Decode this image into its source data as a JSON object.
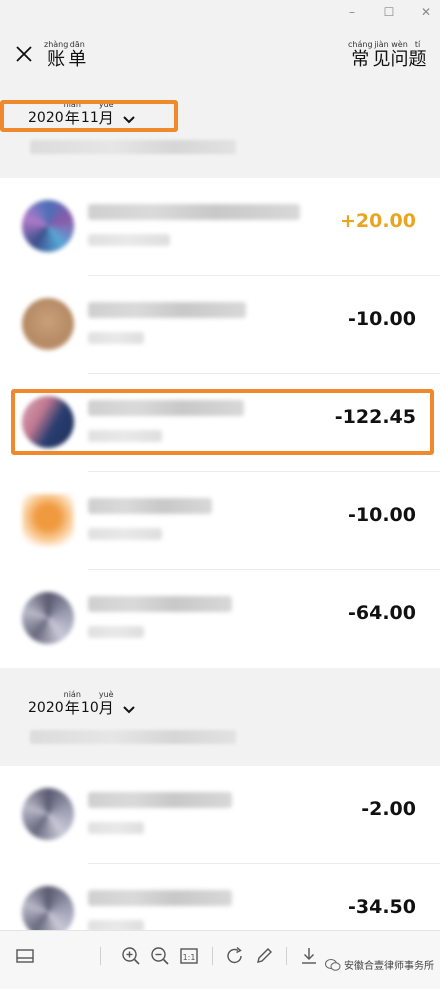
{
  "window": {
    "minimize_label": "–",
    "maximize_label": "☐",
    "close_label": "✕"
  },
  "header": {
    "title_chars": [
      {
        "py": "zhàng",
        "hz": "账"
      },
      {
        "py": "dān",
        "hz": "单"
      }
    ],
    "faq_chars": [
      {
        "py": "cháng",
        "hz": "常"
      },
      {
        "py": "jiàn",
        "hz": "见"
      },
      {
        "py": "wèn",
        "hz": "问"
      },
      {
        "py": "tí",
        "hz": "题"
      }
    ]
  },
  "months": [
    {
      "year": "2020",
      "year_char": {
        "py": "nián",
        "hz": "年"
      },
      "month": "11",
      "month_char": {
        "py": "yuè",
        "hz": "月"
      },
      "transactions": [
        {
          "amount": "+20.00",
          "type": "income"
        },
        {
          "amount": "-10.00",
          "type": "expense"
        },
        {
          "amount": "-122.45",
          "type": "expense"
        },
        {
          "amount": "-10.00",
          "type": "expense"
        },
        {
          "amount": "-64.00",
          "type": "expense"
        }
      ]
    },
    {
      "year": "2020",
      "year_char": {
        "py": "nián",
        "hz": "年"
      },
      "month": "10",
      "month_char": {
        "py": "yuè",
        "hz": "月"
      },
      "transactions": [
        {
          "amount": "-2.00",
          "type": "expense"
        },
        {
          "amount": "-34.50",
          "type": "expense"
        }
      ]
    }
  ],
  "highlight_color": "#f0892c",
  "income_color": "#e9a520",
  "watermark": "安徽合壹律师事务所",
  "toolbar_icons": [
    "layout-icon",
    "zoom-in-icon",
    "zoom-out-icon",
    "actual-size-icon",
    "rotate-icon",
    "edit-icon",
    "download-icon"
  ]
}
